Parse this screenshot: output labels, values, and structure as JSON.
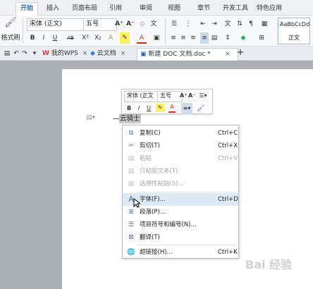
{
  "menu_tabs": [
    "开始",
    "插入",
    "页面布局",
    "引用",
    "审阅",
    "视图",
    "章节",
    "开发工具",
    "特色应用"
  ],
  "ribbon": {
    "format_painter_label": "格式刷",
    "font_name": "宋体 (正文)",
    "font_size": "五号",
    "grow_font": "A⁺",
    "shrink_font": "A⁻",
    "bold": "B",
    "italic": "I",
    "underline": "U",
    "strike": "AB",
    "superscript": "X²",
    "subscript": "X₂",
    "font_color": "A",
    "style_preview": "AaBbCcDd",
    "style_name": "正文"
  },
  "doc_tabs": {
    "home": "我的WPS",
    "cloud": "云文档",
    "active": "新建 DOC 文档.doc *",
    "add": "+"
  },
  "mini_toolbar": {
    "font_name": "宋体 (正文",
    "font_size": "五号",
    "grow": "A⁺",
    "shrink": "A⁻",
    "bold": "B",
    "italic": "I",
    "underline": "U",
    "font_color": "A"
  },
  "document": {
    "selected_text": "云骑士"
  },
  "context_menu": {
    "items": [
      {
        "label": "复制(C)",
        "shortcut": "Ctrl+C",
        "icon": "copy-icon",
        "enabled": true
      },
      {
        "label": "剪切(T)",
        "shortcut": "Ctrl+X",
        "icon": "cut-icon",
        "enabled": true
      },
      {
        "label": "粘贴",
        "shortcut": "Ctrl+V",
        "icon": "paste-icon",
        "enabled": false
      },
      {
        "label": "只粘贴文本(T)",
        "shortcut": "",
        "icon": "paste-text-icon",
        "enabled": false
      },
      {
        "label": "选择性粘贴(S)...",
        "shortcut": "",
        "icon": "paste-special-icon",
        "enabled": false
      },
      {
        "label": "字体(F)...",
        "shortcut": "Ctrl+D",
        "icon": "font-icon",
        "enabled": true
      },
      {
        "label": "段落(P)...",
        "shortcut": "",
        "icon": "paragraph-icon",
        "enabled": true
      },
      {
        "label": "项目符号和编号(N)...",
        "shortcut": "",
        "icon": "bullets-icon",
        "enabled": true
      },
      {
        "label": "翻译(T)",
        "shortcut": "",
        "icon": "translate-icon",
        "enabled": true
      },
      {
        "label": "超链接(H)...",
        "shortcut": "Ctrl+K",
        "icon": "hyperlink-icon",
        "enabled": true
      }
    ]
  },
  "watermark": "Bai 经验"
}
